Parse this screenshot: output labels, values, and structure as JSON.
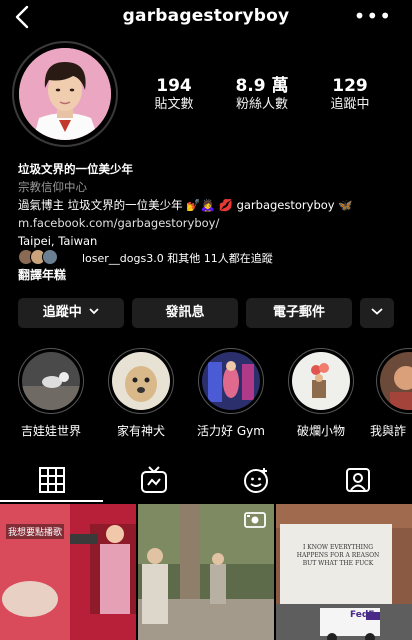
{
  "header": {
    "username": "garbagestoryboy"
  },
  "stats": [
    {
      "value": "194",
      "label": "貼文數"
    },
    {
      "value": "8.9 萬",
      "label": "粉絲人數"
    },
    {
      "value": "129",
      "label": "追蹤中"
    }
  ],
  "bio": {
    "name": "垃圾文界的一位美少年",
    "category": "宗教信仰中心",
    "line1": "過氣博主 垃圾文界的一位美少年 💅🙇‍♀️ 💋 garbagestoryboy 🦋",
    "link": "m.facebook.com/garbagestoryboy/",
    "location": "Taipei, Taiwan",
    "followed_by": "loser__dogs3.0 和其他 11人都在追蹤",
    "translate": "翻譯年糕"
  },
  "actions": {
    "following": "追蹤中",
    "message": "發訊息",
    "email": "電子郵件"
  },
  "highlights": [
    {
      "label": "吉娃娃世界"
    },
    {
      "label": "家有神犬"
    },
    {
      "label": "活力好 Gym"
    },
    {
      "label": "破爛小物"
    },
    {
      "label": "我與詐"
    }
  ],
  "grid": {
    "post1_caption": "我想要點播歌",
    "post3_sign": "I KNOW EVERYTHING HAPPENS FOR A REASON BUT WHAT THE FUCK",
    "post3_truck": "FedEx"
  },
  "icons": [
    "back-arrow-icon",
    "more-icon",
    "chevron-down-icon",
    "grid-icon",
    "igtv-icon",
    "reels-icon",
    "tagged-icon",
    "video-icon"
  ]
}
